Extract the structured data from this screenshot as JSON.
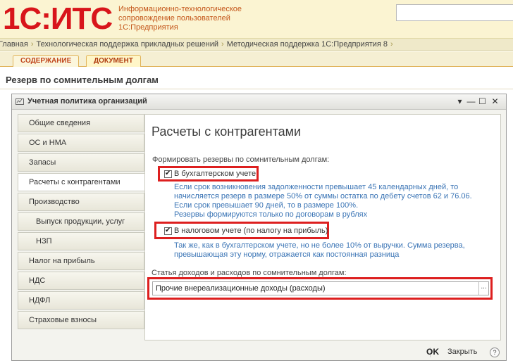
{
  "header": {
    "logo": "1С:ИТС",
    "tagline": [
      "Информационно-технологическое",
      "сопровождение пользователей",
      "1С:Предприятия"
    ],
    "search": {
      "value": "",
      "placeholder": ""
    }
  },
  "breadcrumb": [
    "Главная",
    "Технологическая поддержка прикладных решений",
    "Методическая поддержка 1С:Предприятия 8"
  ],
  "tabs": [
    {
      "label": "СОДЕРЖАНИЕ",
      "active": false
    },
    {
      "label": "ДОКУМЕНТ",
      "active": true
    }
  ],
  "page_title": "Резерв по сомнительным долгам",
  "window": {
    "title": "Учетная политика организаций",
    "controls": {
      "menu": "▾",
      "minimize": "—",
      "maximize": "☐",
      "close": "✕"
    },
    "nav": [
      {
        "label": "Общие сведения",
        "active": false
      },
      {
        "label": "ОС и НМА",
        "active": false
      },
      {
        "label": "Запасы",
        "active": false
      },
      {
        "label": "Расчеты с контрагентами",
        "active": true
      },
      {
        "label": "Производство",
        "active": false
      },
      {
        "label": "Выпуск продукции, услуг",
        "active": false
      },
      {
        "label": "НЗП",
        "active": false
      },
      {
        "label": "Налог на прибыль",
        "active": false
      },
      {
        "label": "НДС",
        "active": false
      },
      {
        "label": "НДФЛ",
        "active": false
      },
      {
        "label": "Страховые взносы",
        "active": false
      }
    ],
    "content": {
      "title": "Расчеты с контрагентами",
      "reserves_label": "Формировать резервы по сомнительным долгам:",
      "accounting_checkbox": {
        "label": "В бухгалтерском учете",
        "checked": true
      },
      "accounting_note": [
        "Если срок возникновения задолженности превышает 45 календарных дней, то",
        "начисляется резерв в размере 50% от суммы остатка по дебету счетов 62 и 76.06.",
        "Если срок превышает 90 дней, то в размере 100%.",
        "Резервы формируются только по договорам в рублях"
      ],
      "tax_checkbox": {
        "label": "В налоговом учете (по налогу на прибыль)",
        "checked": true
      },
      "tax_note": [
        "Так же, как в бухгалтерском учете, но не более 10% от выручки. Сумма резерва,",
        "превышающая эту норму, отражается как постоянная разница"
      ],
      "income_label": "Статья доходов и расходов по сомнительным долгам:",
      "income_value": "Прочие внереализационные доходы (расходы)",
      "income_button": "..."
    },
    "footer": {
      "ok": "OK",
      "close": "Закрыть",
      "help": "?"
    }
  },
  "colors": {
    "logo": "#d8151b",
    "tagline": "#c4561a",
    "note": "#3a74b5",
    "highlight": "#dd1f1f"
  }
}
